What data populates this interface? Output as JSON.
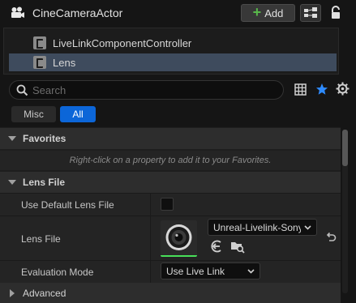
{
  "header": {
    "actor_name": "CineCameraActor",
    "add_label": "Add"
  },
  "components": [
    {
      "label": "LiveLinkComponentController",
      "selected": false
    },
    {
      "label": "Lens",
      "selected": true
    }
  ],
  "search": {
    "placeholder": "Search"
  },
  "filters": {
    "misc_label": "Misc",
    "all_label": "All",
    "active": "All"
  },
  "categories": {
    "favorites": {
      "label": "Favorites",
      "hint": "Right-click on a property to add it to your Favorites."
    },
    "lens_file": {
      "label": "Lens File",
      "properties": {
        "use_default": {
          "label": "Use Default Lens File",
          "checked": false
        },
        "lens_file": {
          "label": "Lens File",
          "value": "Unreal-Livelink-Sony"
        },
        "evaluation_mode": {
          "label": "Evaluation Mode",
          "value": "Use Live Link"
        }
      }
    },
    "advanced": {
      "label": "Advanced"
    }
  },
  "colors": {
    "accent_blue": "#0c66d8",
    "add_plus": "#58b84a",
    "selection": "#3e4b5d",
    "asset_underline": "#48e05a",
    "favorite_star": "#2e8bff"
  }
}
